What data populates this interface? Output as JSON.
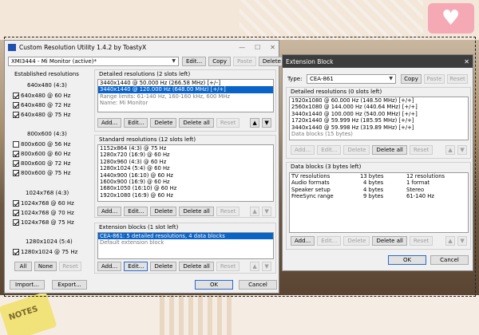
{
  "background": {
    "sticker_text": "NOTES"
  },
  "cru": {
    "title": "Custom Resolution Utility 1.4.2 by ToastyX",
    "monitor_select": "XMI3444 - Mi Monitor (active)*",
    "top_buttons": [
      "Edit...",
      "Copy",
      "Paste",
      "Delete"
    ],
    "established": {
      "heading": "Established resolutions",
      "groups": [
        {
          "title": "640x480 (4:3)",
          "items": [
            {
              "label": "640x480 @ 60 Hz",
              "checked": true
            },
            {
              "label": "640x480 @ 72 Hz",
              "checked": true
            },
            {
              "label": "640x480 @ 75 Hz",
              "checked": true
            }
          ]
        },
        {
          "title": "800x600 (4:3)",
          "items": [
            {
              "label": "800x600 @ 56 Hz",
              "checked": false
            },
            {
              "label": "800x600 @ 60 Hz",
              "checked": true
            },
            {
              "label": "800x600 @ 72 Hz",
              "checked": true
            },
            {
              "label": "800x600 @ 75 Hz",
              "checked": true
            }
          ]
        },
        {
          "title": "1024x768 (4:3)",
          "items": [
            {
              "label": "1024x768 @ 60 Hz",
              "checked": true
            },
            {
              "label": "1024x768 @ 70 Hz",
              "checked": true
            },
            {
              "label": "1024x768 @ 75 Hz",
              "checked": true
            }
          ]
        },
        {
          "title": "1280x1024 (5:4)",
          "items": [
            {
              "label": "1280x1024 @ 75 Hz",
              "checked": true
            }
          ]
        }
      ],
      "buttons": [
        "All",
        "None",
        "Reset"
      ]
    },
    "detailed": {
      "heading": "Detailed resolutions (2 slots left)",
      "rows": [
        "3440x1440 @ 50.000 Hz (266.58 MHz) [+/–]",
        "3440x1440 @ 120.000 Hz (648.00 MHz) [+/+]",
        "Range limits: 61-140 Hz, 160-160 kHz, 600 MHz",
        "Name: Mi Monitor"
      ],
      "buttons": [
        "Add...",
        "Edit...",
        "Delete",
        "Delete all",
        "Reset"
      ]
    },
    "standard": {
      "heading": "Standard resolutions (12 slots left)",
      "rows": [
        "1152x864 (4:3) @ 75 Hz",
        "1280x720 (16:9) @ 60 Hz",
        "1280x960 (4:3) @ 60 Hz",
        "1280x1024 (5:4) @ 60 Hz",
        "1440x900 (16:10) @ 60 Hz",
        "1600x900 (16:9) @ 60 Hz",
        "1680x1050 (16:10) @ 60 Hz",
        "1920x1080 (16:9) @ 60 Hz"
      ],
      "buttons": [
        "Add...",
        "Edit...",
        "Delete",
        "Delete all",
        "Reset"
      ]
    },
    "extension": {
      "heading": "Extension blocks (1 slot left)",
      "rows": [
        "CEA-861: 5 detailed resolutions, 4 data blocks",
        "Default extension block"
      ],
      "buttons": [
        "Add...",
        "Edit...",
        "Delete",
        "Delete all",
        "Reset"
      ]
    },
    "bottom_buttons": [
      "Import...",
      "Export...",
      "OK",
      "Cancel"
    ]
  },
  "ext": {
    "title": "Extension Block",
    "type_label": "Type:",
    "type_value": "CEA-861",
    "top_buttons": [
      "Copy",
      "Paste",
      "Reset"
    ],
    "detailed": {
      "heading": "Detailed resolutions (0 slots left)",
      "rows": [
        "1920x1080 @ 60.000 Hz (148.50 MHz) [+/+]",
        "2560x1080 @ 144.000 Hz (440.64 MHz) [+/+]",
        "3440x1440 @ 100.000 Hz (540.00 MHz) [+/+]",
        "1720x1440 @ 59.999 Hz (185.95 MHz) [+/+]",
        "3440x1440 @ 59.998 Hz (319.89 MHz) [+/+]",
        "Data blocks (15 bytes)"
      ],
      "buttons": [
        "Add...",
        "Edit...",
        "Delete",
        "Delete all",
        "Reset"
      ]
    },
    "datablocks": {
      "heading": "Data blocks (3 bytes left)",
      "rows": [
        [
          "TV resolutions",
          "13 bytes",
          "12 resolutions"
        ],
        [
          "Audio formats",
          "4 bytes",
          "1 format"
        ],
        [
          "Speaker setup",
          "4 bytes",
          "Stereo"
        ],
        [
          "FreeSync range",
          "9 bytes",
          "61-140 Hz"
        ]
      ],
      "buttons": [
        "Add...",
        "Edit...",
        "Delete",
        "Delete all",
        "Reset"
      ]
    },
    "bottom_buttons": [
      "OK",
      "Cancel"
    ]
  }
}
